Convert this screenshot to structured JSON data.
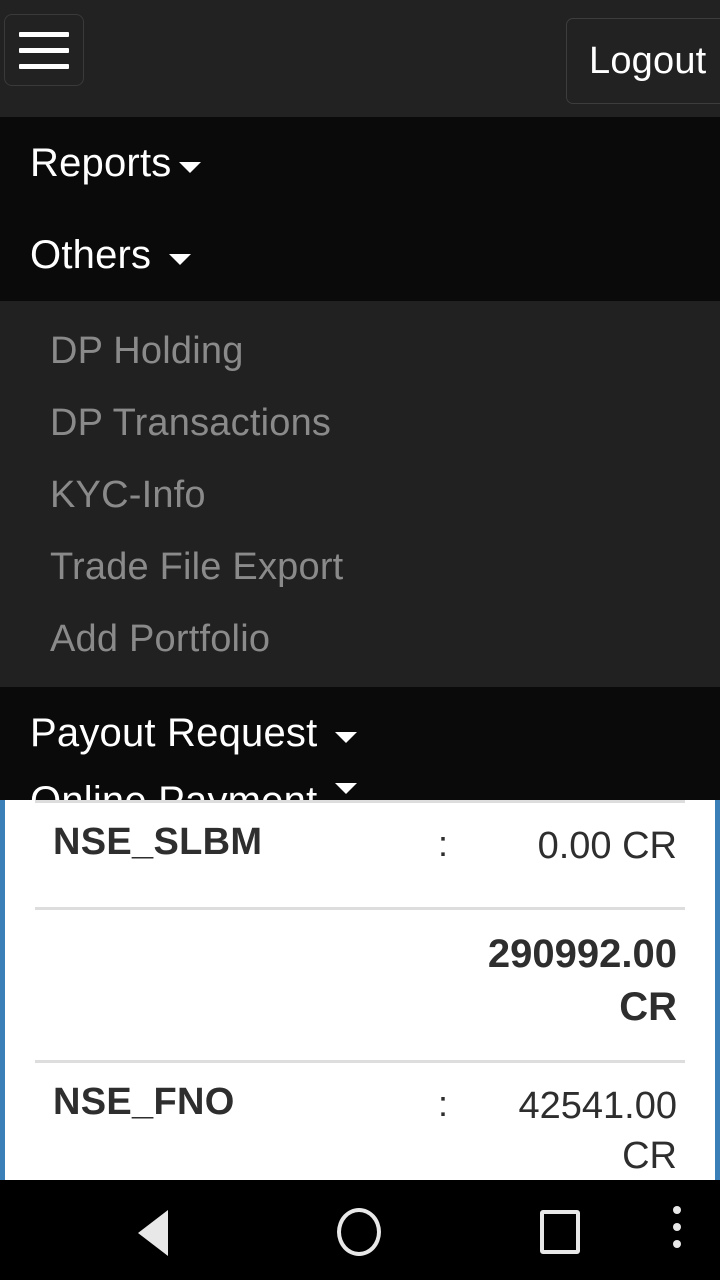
{
  "appbar": {
    "menu_icon": "hamburger-menu-icon",
    "logout_label": "Logout"
  },
  "nav": {
    "items": [
      {
        "label": "Reports",
        "icon": "chevron-down-icon",
        "expanded": false
      },
      {
        "label": "Others",
        "icon": "chevron-down-icon",
        "expanded": true
      },
      {
        "label": "Payout Request",
        "icon": "chevron-down-icon",
        "expanded": false
      },
      {
        "label": "Online Payment",
        "icon": "chevron-down-icon",
        "expanded": false
      }
    ],
    "submenu": [
      {
        "label": "DP Holding"
      },
      {
        "label": "DP Transactions"
      },
      {
        "label": "KYC-Info"
      },
      {
        "label": "Trade File Export"
      },
      {
        "label": "Add Portfolio"
      }
    ]
  },
  "ledger": {
    "accent_color": "#3b7fb8",
    "separator": ":",
    "rows": [
      {
        "label": "NSE_SLBM",
        "separator": ":",
        "value": "0.00 CR",
        "bold": false
      },
      {
        "label": "",
        "separator": "",
        "value": "290992.00 CR",
        "bold": true
      },
      {
        "label": "NSE_FNO",
        "separator": ":",
        "value": "42541.00 CR",
        "bold": false
      }
    ]
  },
  "system_nav": {
    "back": "back-triangle-icon",
    "home": "home-circle-icon",
    "recents": "recents-square-icon",
    "overflow": "overflow-dots-icon"
  }
}
